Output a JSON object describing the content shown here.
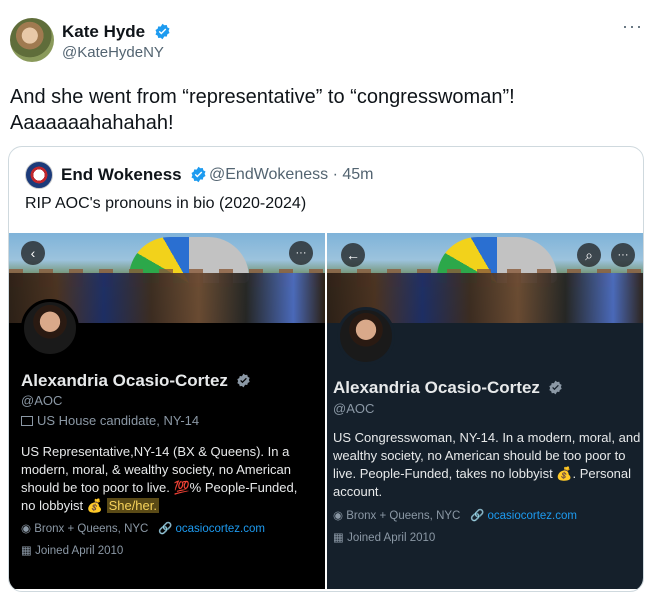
{
  "tweet": {
    "author_name": "Kate Hyde",
    "author_handle": "@KateHydeNY",
    "more": "···",
    "text_line1": "And she went from “representative” to “congresswoman”!",
    "text_line2": "Aaaaaaahahahah!"
  },
  "quote": {
    "author_name": "End Wokeness",
    "author_handle": "@EndWokeness · 45m",
    "text": "RIP AOC's pronouns in bio (2020-2024)"
  },
  "left_profile": {
    "name": "Alexandria Ocasio-Cortez",
    "handle": "@AOC",
    "candidate_line": "US House candidate, NY-14",
    "bio1": "US Representative,NY-14 (BX & Queens). In a",
    "bio2": "modern, moral, & wealthy society, no American",
    "bio3": "should be too poor to live. 💯% People-Funded,",
    "bio4_prefix": "no lobbyist 💰 ",
    "pronouns": "She/her.",
    "location": "Bronx + Queens, NYC",
    "website": "ocasiocortez.com",
    "joined": "Joined April 2010",
    "more_btn": "···",
    "back_btn": "‹"
  },
  "right_profile": {
    "name": "Alexandria Ocasio-Cortez",
    "handle": "@AOC",
    "bio1": "US Congresswoman, NY-14. In a modern, moral, and",
    "bio2": "wealthy society, no American should be too poor to",
    "bio3": "live. People-Funded, takes no lobbyist 💰. Personal",
    "bio4": "account.",
    "location": "Bronx + Queens, NYC",
    "website": "ocasiocortez.com",
    "joined": "Joined April 2010",
    "more_btn": "···",
    "back_btn": "←",
    "search_btn": "⌕"
  },
  "colors": {
    "verified_blue": "#1d9bf0",
    "link_blue": "#1d9bf0",
    "highlight": "#f7d35b"
  }
}
